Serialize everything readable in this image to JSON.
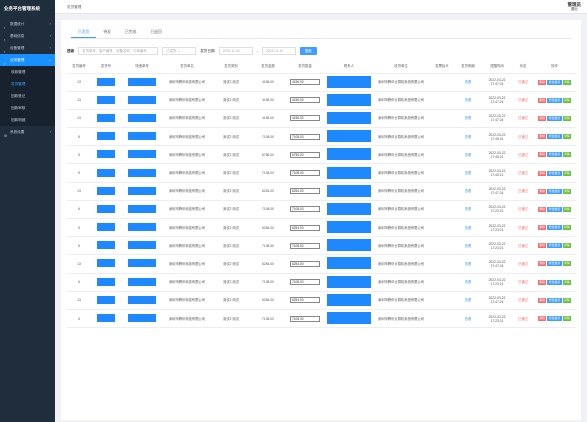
{
  "sidebar": {
    "brand": "业务平台管理系统",
    "items": [
      {
        "label": "数据统计",
        "arrow": "›"
      },
      {
        "label": "基础信息",
        "arrow": "›"
      },
      {
        "label": "设备管理",
        "arrow": "›"
      },
      {
        "label": "业务管理",
        "arrow": "⌄",
        "active": true
      }
    ],
    "subitems": [
      {
        "label": "收款管理"
      },
      {
        "label": "发货管理",
        "active": true
      },
      {
        "label": "回款登记"
      },
      {
        "label": "回款审核"
      },
      {
        "label": "回款明细"
      }
    ],
    "last": {
      "label": "系统设置",
      "arrow": "›"
    }
  },
  "topbar": {
    "crumb": "发货管理",
    "user_icon": "管理员",
    "user_label": "退出"
  },
  "tabs": [
    {
      "label": "已发货",
      "active": true
    },
    {
      "label": "待发"
    },
    {
      "label": "已完成"
    },
    {
      "label": "已退回"
    }
  ],
  "filter": {
    "label": "搜索",
    "placeholder": "发货单号、客户编号、设备名称、订单编号",
    "select": "已发货",
    "date_label": "发货日期",
    "date_start": "2023-11-03",
    "date_end": "2023-01-10",
    "search_btn": "搜索"
  },
  "columns": [
    "发货编号",
    "发货号",
    "快递单号",
    "发货单名",
    "发货类别",
    "发货金额",
    "发货数量",
    "联系人",
    "收货单位",
    "发票抬头",
    "发货明细",
    "提醒时间",
    "状态",
    "操作"
  ],
  "rows": [
    {
      "no": "13",
      "name": "深圳市腾讯科技有限公司",
      "cat": "测试2 测试",
      "amount": "4156.00",
      "qty": "4156.00",
      "unit": "深圳市腾讯计算机系统有限公司",
      "detail": "查看",
      "date": "2022-03-22",
      "time": "17:47:24",
      "status": "已通过"
    },
    {
      "no": "13",
      "name": "深圳市腾讯科技有限公司",
      "cat": "测试2 测试",
      "amount": "4156.00",
      "qty": "4156.00",
      "unit": "深圳市腾讯计算机系统有限公司",
      "detail": "查看",
      "date": "2022-03-22",
      "time": "17:47:24",
      "status": "已通过"
    },
    {
      "no": "13",
      "name": "深圳市腾讯科技有限公司",
      "cat": "测试2 测试",
      "amount": "4156.00",
      "qty": "4156.00",
      "unit": "深圳市腾讯计算机系统有限公司",
      "detail": "查看",
      "date": "2022-03-22",
      "time": "17:47:24",
      "status": "已通过"
    },
    {
      "no": "6",
      "name": "深圳市腾讯科技有限公司",
      "cat": "测试2 测试",
      "amount": "7108.00",
      "qty": "7108.00",
      "unit": "深圳市腾讯计算机系统有限公司",
      "detail": "查看",
      "date": "2022-03-22",
      "time": "17:45:31",
      "status": "已通过"
    },
    {
      "no": "5",
      "name": "深圳市腾讯科技有限公司",
      "cat": "测试2 测试",
      "amount": "6756.00",
      "qty": "6756.00",
      "unit": "深圳市腾讯计算机系统有限公司",
      "detail": "查看",
      "date": "2022-03-22",
      "time": "17:45:21",
      "status": "已通过"
    },
    {
      "no": "5",
      "name": "深圳市腾讯科技有限公司",
      "cat": "测试2 测试",
      "amount": "7108.00",
      "qty": "7108.00",
      "unit": "深圳市腾讯计算机系统有限公司",
      "detail": "查看",
      "date": "2022-03-22",
      "time": "17:45:21",
      "status": "已通过"
    },
    {
      "no": "13",
      "name": "深圳市腾讯科技有限公司",
      "cat": "测试2 测试",
      "amount": "6254.00",
      "qty": "6254.00",
      "unit": "深圳市腾讯计算机系统有限公司",
      "detail": "查看",
      "date": "2022-03-22",
      "time": "17:47:24",
      "status": "已通过"
    },
    {
      "no": "6",
      "name": "深圳市腾讯科技有限公司",
      "cat": "测试2 测试",
      "amount": "7108.00",
      "qty": "7108.00",
      "unit": "深圳市腾讯计算机系统有限公司",
      "detail": "查看",
      "date": "2022-03-22",
      "time": "17:23:21",
      "status": "已通过"
    },
    {
      "no": "5",
      "name": "深圳市腾讯科技有限公司",
      "cat": "测试2 测试",
      "amount": "6254.00",
      "qty": "6254.00",
      "unit": "深圳市腾讯计算机系统有限公司",
      "detail": "查看",
      "date": "2022-03-22",
      "time": "17:23:21",
      "status": "已通过"
    },
    {
      "no": "6",
      "name": "深圳市腾讯科技有限公司",
      "cat": "测试2 测试",
      "amount": "7108.00",
      "qty": "7108.00",
      "unit": "深圳市腾讯计算机系统有限公司",
      "detail": "查看",
      "date": "2022-03-22",
      "time": "17:23:21",
      "status": "已通过"
    },
    {
      "no": "13",
      "name": "深圳市腾讯科技有限公司",
      "cat": "测试2 测试",
      "amount": "6254.00",
      "qty": "6254.00",
      "unit": "深圳市腾讯计算机系统有限公司",
      "detail": "查看",
      "date": "2022-03-22",
      "time": "17:47:24",
      "status": "已通过"
    },
    {
      "no": "6",
      "name": "深圳市腾讯科技有限公司",
      "cat": "测试2 测试",
      "amount": "7108.00",
      "qty": "7108.00",
      "unit": "深圳市腾讯计算机系统有限公司",
      "detail": "查看",
      "date": "2022-03-22",
      "time": "17:23:21",
      "status": "已通过"
    },
    {
      "no": "13",
      "name": "深圳市腾讯科技有限公司",
      "cat": "测试2 测试",
      "amount": "6254.00",
      "qty": "6254.00",
      "unit": "深圳市腾讯计算机系统有限公司",
      "detail": "查看",
      "date": "2022-03-22",
      "time": "17:47:24",
      "status": "已通过"
    },
    {
      "no": "6",
      "name": "深圳市腾讯科技有限公司",
      "cat": "测试2 测试",
      "amount": "7108.00",
      "qty": "7108.00",
      "unit": "深圳市腾讯计算机系统有限公司",
      "detail": "查看",
      "date": "2022-03-22",
      "time": "17:23:21",
      "status": "已通过"
    }
  ],
  "ops": {
    "a": "删除",
    "b": "修改发货",
    "c": "详情"
  },
  "colors": {
    "sidebar": "#1f2d3d",
    "accent": "#409eff",
    "danger": "#f56c6c",
    "success": "#67c23a",
    "redact": "#1e88ff"
  }
}
